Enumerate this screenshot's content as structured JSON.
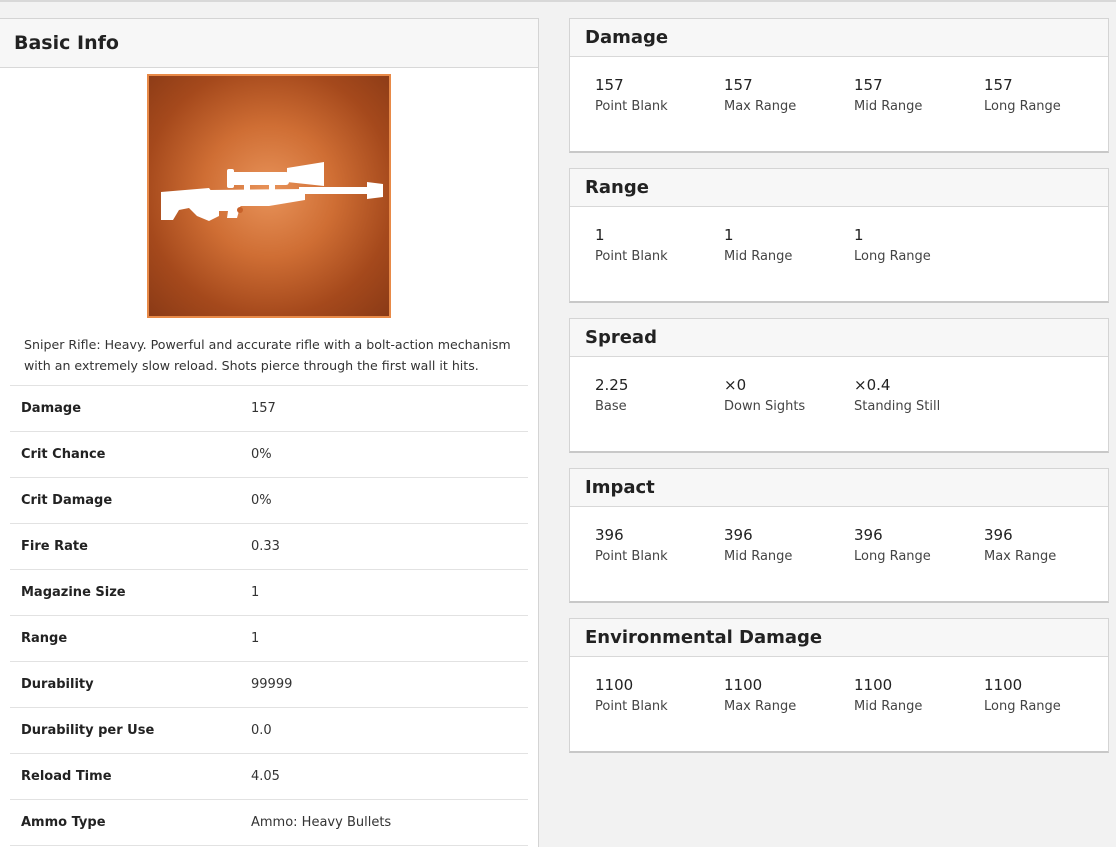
{
  "basic_info": {
    "title": "Basic Info",
    "weapon_icon": "sniper-rifle-icon",
    "description": "Sniper Rifle: Heavy. Powerful and accurate rifle with a bolt-action mechanism with an extremely slow reload. Shots pierce through the first wall it hits.",
    "stats": [
      {
        "label": "Damage",
        "value": "157"
      },
      {
        "label": "Crit Chance",
        "value": "0%"
      },
      {
        "label": "Crit Damage",
        "value": "0%"
      },
      {
        "label": "Fire Rate",
        "value": "0.33"
      },
      {
        "label": "Magazine Size",
        "value": "1"
      },
      {
        "label": "Range",
        "value": "1"
      },
      {
        "label": "Durability",
        "value": "99999"
      },
      {
        "label": "Durability per Use",
        "value": "0.0"
      },
      {
        "label": "Reload Time",
        "value": "4.05"
      },
      {
        "label": "Ammo Type",
        "value": "Ammo: Heavy Bullets"
      }
    ]
  },
  "cards": [
    {
      "title": "Damage",
      "metrics": [
        {
          "value": "157",
          "label": "Point Blank"
        },
        {
          "value": "157",
          "label": "Max Range"
        },
        {
          "value": "157",
          "label": "Mid Range"
        },
        {
          "value": "157",
          "label": "Long Range"
        }
      ]
    },
    {
      "title": "Range",
      "metrics": [
        {
          "value": "1",
          "label": "Point Blank"
        },
        {
          "value": "1",
          "label": "Mid Range"
        },
        {
          "value": "1",
          "label": "Long Range"
        }
      ]
    },
    {
      "title": "Spread",
      "metrics": [
        {
          "value": "2.25",
          "label": "Base"
        },
        {
          "value": "×0",
          "label": "Down Sights"
        },
        {
          "value": "×0.4",
          "label": "Standing Still"
        }
      ]
    },
    {
      "title": "Impact",
      "metrics": [
        {
          "value": "396",
          "label": "Point Blank"
        },
        {
          "value": "396",
          "label": "Mid Range"
        },
        {
          "value": "396",
          "label": "Long Range"
        },
        {
          "value": "396",
          "label": "Max Range"
        }
      ]
    },
    {
      "title": "Environmental Damage",
      "metrics": [
        {
          "value": "1100",
          "label": "Point Blank"
        },
        {
          "value": "1100",
          "label": "Max Range"
        },
        {
          "value": "1100",
          "label": "Mid Range"
        },
        {
          "value": "1100",
          "label": "Long Range"
        }
      ]
    }
  ],
  "colors": {
    "image_border": "#e88a48",
    "image_center": "#e8935a",
    "image_edge": "#8a3a16"
  }
}
